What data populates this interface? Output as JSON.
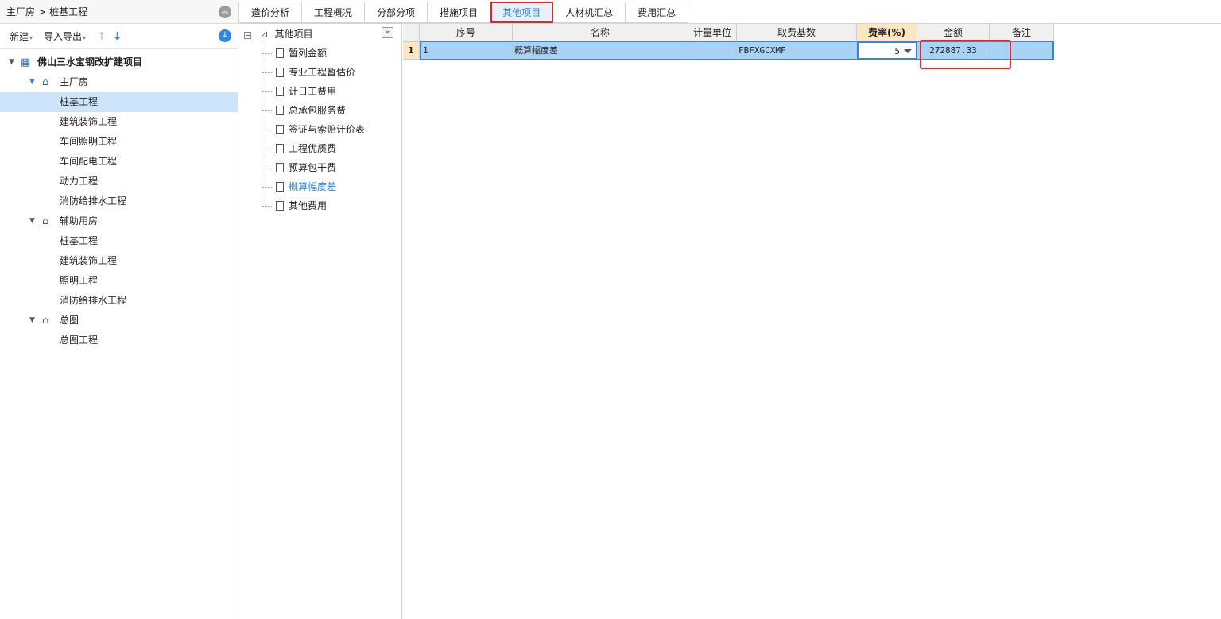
{
  "breadcrumb": {
    "parent": "主厂房",
    "sep": ">",
    "current": "桩基工程"
  },
  "left_toolbar": {
    "new_label": "新建",
    "import_export_label": "导入导出"
  },
  "tree": {
    "root": "佛山三水宝钢改扩建项目",
    "groups": [
      {
        "label": "主厂房",
        "children": [
          "桩基工程",
          "建筑装饰工程",
          "车间照明工程",
          "车间配电工程",
          "动力工程",
          "消防给排水工程"
        ]
      },
      {
        "label": "辅助用房",
        "children": [
          "桩基工程",
          "建筑装饰工程",
          "照明工程",
          "消防给排水工程"
        ]
      },
      {
        "label": "总图",
        "children": [
          "总图工程"
        ]
      }
    ]
  },
  "tabs": [
    "造价分析",
    "工程概况",
    "分部分项",
    "措施项目",
    "其他项目",
    "人材机汇总",
    "费用汇总"
  ],
  "other_tree": {
    "root": "其他项目",
    "items": [
      "暂列金额",
      "专业工程暂估价",
      "计日工费用",
      "总承包服务费",
      "签证与索赔计价表",
      "工程优质费",
      "预算包干费",
      "概算幅度差",
      "其他费用"
    ]
  },
  "grid": {
    "headers": [
      "序号",
      "名称",
      "计量单位",
      "取费基数",
      "费率(%)",
      "金额",
      "备注"
    ],
    "rows": [
      {
        "row_num": "1",
        "seq": "1",
        "name": "概算幅度差",
        "unit": "",
        "base": "FBFXGCXMF",
        "rate": "5",
        "amount": "272887.33",
        "remark": ""
      }
    ]
  },
  "colors": {
    "accent": "#2f86e8",
    "highlight": "#e82424",
    "selection": "#a9d2f7"
  }
}
